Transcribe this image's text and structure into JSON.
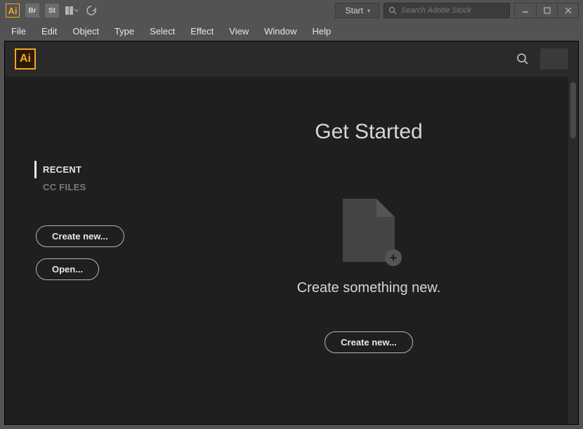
{
  "titlebar": {
    "app_icon_text": "Ai",
    "bridge_text": "Br",
    "stock_text": "St",
    "workspace": {
      "label": "Start"
    },
    "search": {
      "placeholder": "Search Adobe Stock"
    }
  },
  "menubar": {
    "items": [
      "File",
      "Edit",
      "Object",
      "Type",
      "Select",
      "Effect",
      "View",
      "Window",
      "Help"
    ]
  },
  "header": {
    "logo_text": "Ai"
  },
  "sidebar": {
    "tabs": [
      {
        "label": "RECENT",
        "active": true
      },
      {
        "label": "CC FILES",
        "active": false
      }
    ],
    "create_new_label": "Create new...",
    "open_label": "Open..."
  },
  "main": {
    "headline": "Get Started",
    "tagline": "Create something new.",
    "create_new_label": "Create new..."
  }
}
